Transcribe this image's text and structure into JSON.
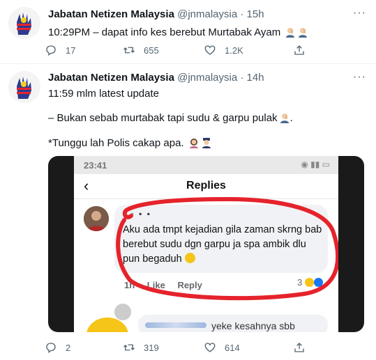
{
  "tweets": [
    {
      "author": {
        "name": "Jabatan Netizen Malaysia",
        "handle": "@jnmalaysia",
        "time": "15h"
      },
      "lines": [
        "10:29PM – dapat info kes berebut Murtabak Ayam"
      ],
      "stats": {
        "replies": "17",
        "retweets": "655",
        "likes": "1.2K"
      }
    },
    {
      "author": {
        "name": "Jabatan Netizen Malaysia",
        "handle": "@jnmalaysia",
        "time": "14h"
      },
      "lines": [
        "11:59 mlm latest update",
        "– Bukan sebab murtabak tapi sudu & garpu pulak",
        "*Tunggu lah Polis cakap apa."
      ],
      "stats": {
        "replies": "2",
        "retweets": "319",
        "likes": "614"
      },
      "media": {
        "status_time": "23:41",
        "screen_title": "Replies",
        "comment_text": "Aku ada tmpt kejadian gila zaman skrng bab berebut sudu dgn garpu ja spa ambik dlu pun begaduh",
        "comment_time": "1h",
        "like_label": "Like",
        "reply_label": "Reply",
        "reaction_count": "3",
        "second_comment_text": "yeke kesahnya sbb"
      }
    }
  ],
  "colors": {
    "secondary": "#536471",
    "annotation": "#e5232b"
  }
}
